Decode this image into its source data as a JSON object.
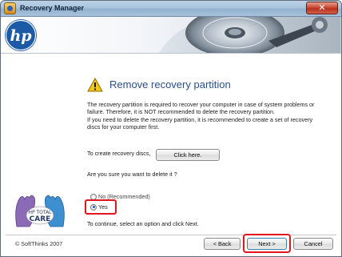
{
  "window": {
    "title": "Recovery Manager",
    "close_label": "✕"
  },
  "banner": {
    "logo_text": "hp"
  },
  "dialog": {
    "heading": "Remove recovery partition",
    "paragraph_lines": [
      "The recovery partition is required to recover your computer in case of system problems or",
      "failure. Therefore, it is NOT recommended to delete the recovery partition.",
      "If you need to delete the recovery partition, it is recommended to create a set of recovery",
      "discs for your computer first."
    ],
    "create_discs_label": "To create recovery discs,",
    "click_here_label": "Click here.",
    "confirm_question": "Are you sure you want to delete it ?",
    "options": [
      {
        "label": "No (Recommended)",
        "selected": false
      },
      {
        "label": "Yes",
        "selected": true
      }
    ],
    "hint": "To continue, select an option and click Next."
  },
  "care_logo": {
    "line1": "HP TOTAL",
    "line2": "CARE"
  },
  "footer": {
    "copyright": "© SoftThinks 2007",
    "back_label": "< Back",
    "next_label": "Next >",
    "cancel_label": "Cancel"
  },
  "colors": {
    "heading": "#2a4f8a",
    "highlight": "#e0151d",
    "hp_blue": "#1c5aa6"
  }
}
